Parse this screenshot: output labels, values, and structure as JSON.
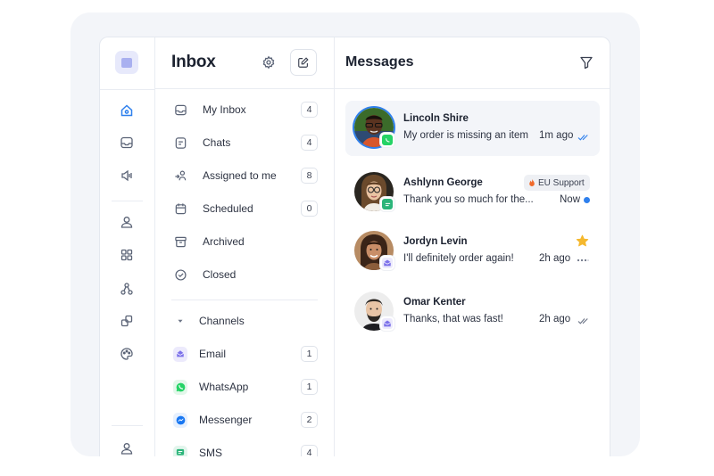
{
  "inbox": {
    "title": "Inbox",
    "items": [
      {
        "label": "My Inbox",
        "count": "4",
        "icon": "inbox-tray-icon"
      },
      {
        "label": "Chats",
        "count": "4",
        "icon": "chat-doc-icon"
      },
      {
        "label": "Assigned to me",
        "count": "8",
        "icon": "assign-icon"
      },
      {
        "label": "Scheduled",
        "count": "0",
        "icon": "calendar-icon"
      },
      {
        "label": "Archived",
        "icon": "archive-icon"
      },
      {
        "label": "Closed",
        "icon": "check-circle-icon"
      }
    ],
    "channels_label": "Channels",
    "channels": [
      {
        "label": "Email",
        "count": "1",
        "icon": "email-icon",
        "color": "#6e62e5"
      },
      {
        "label": "WhatsApp",
        "count": "1",
        "icon": "whatsapp-icon",
        "color": "#25d366"
      },
      {
        "label": "Messenger",
        "count": "2",
        "icon": "messenger-icon",
        "color": "#1877f2"
      },
      {
        "label": "SMS",
        "count": "4",
        "icon": "sms-icon",
        "color": "#2bb57a"
      }
    ]
  },
  "messages": {
    "title": "Messages",
    "conversations": [
      {
        "name": "Lincoln Shire",
        "preview": "My order is missing an item",
        "time": "1m ago",
        "status": "read",
        "channel": "whatsapp",
        "active": true
      },
      {
        "name": "Ashlynn George",
        "preview": "Thank you so much for the...",
        "time": "Now",
        "status": "unread",
        "channel": "sms",
        "tag": "EU Support",
        "tag_icon": "fire-icon"
      },
      {
        "name": "Jordyn Levin",
        "preview": "I'll definitely order again!",
        "time": "2h ago",
        "status": "typing",
        "channel": "email",
        "starred": true
      },
      {
        "name": "Omar Kenter",
        "preview": "Thanks, that was fast!",
        "time": "2h ago",
        "status": "read",
        "channel": "email"
      }
    ]
  },
  "colors": {
    "accent": "#2f80ed",
    "logo_bg": "#e7e9fb",
    "star": "#f5b82e",
    "active_bg": "#f3f5f9"
  }
}
